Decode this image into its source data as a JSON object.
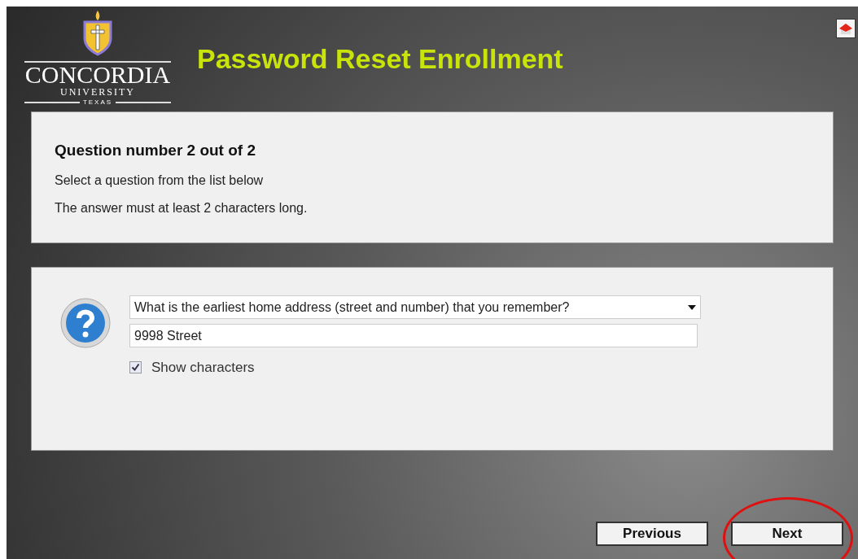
{
  "logo": {
    "name": "CONCORDIA",
    "line2": "UNIVERSITY",
    "line3": "TEXAS"
  },
  "title": "Password Reset Enrollment",
  "info": {
    "heading": "Question number 2 out of 2",
    "lines": [
      "Select a question from the list below",
      "The answer must at least 2 characters long."
    ]
  },
  "question": {
    "selected": "What is the earliest home address (street and number) that you remember?",
    "answer": "9998 Street",
    "show_characters": {
      "label": "Show characters",
      "checked": true
    }
  },
  "buttons": [
    {
      "label": "Previous",
      "highlighted": false
    },
    {
      "label": "Next",
      "highlighted": true
    }
  ]
}
